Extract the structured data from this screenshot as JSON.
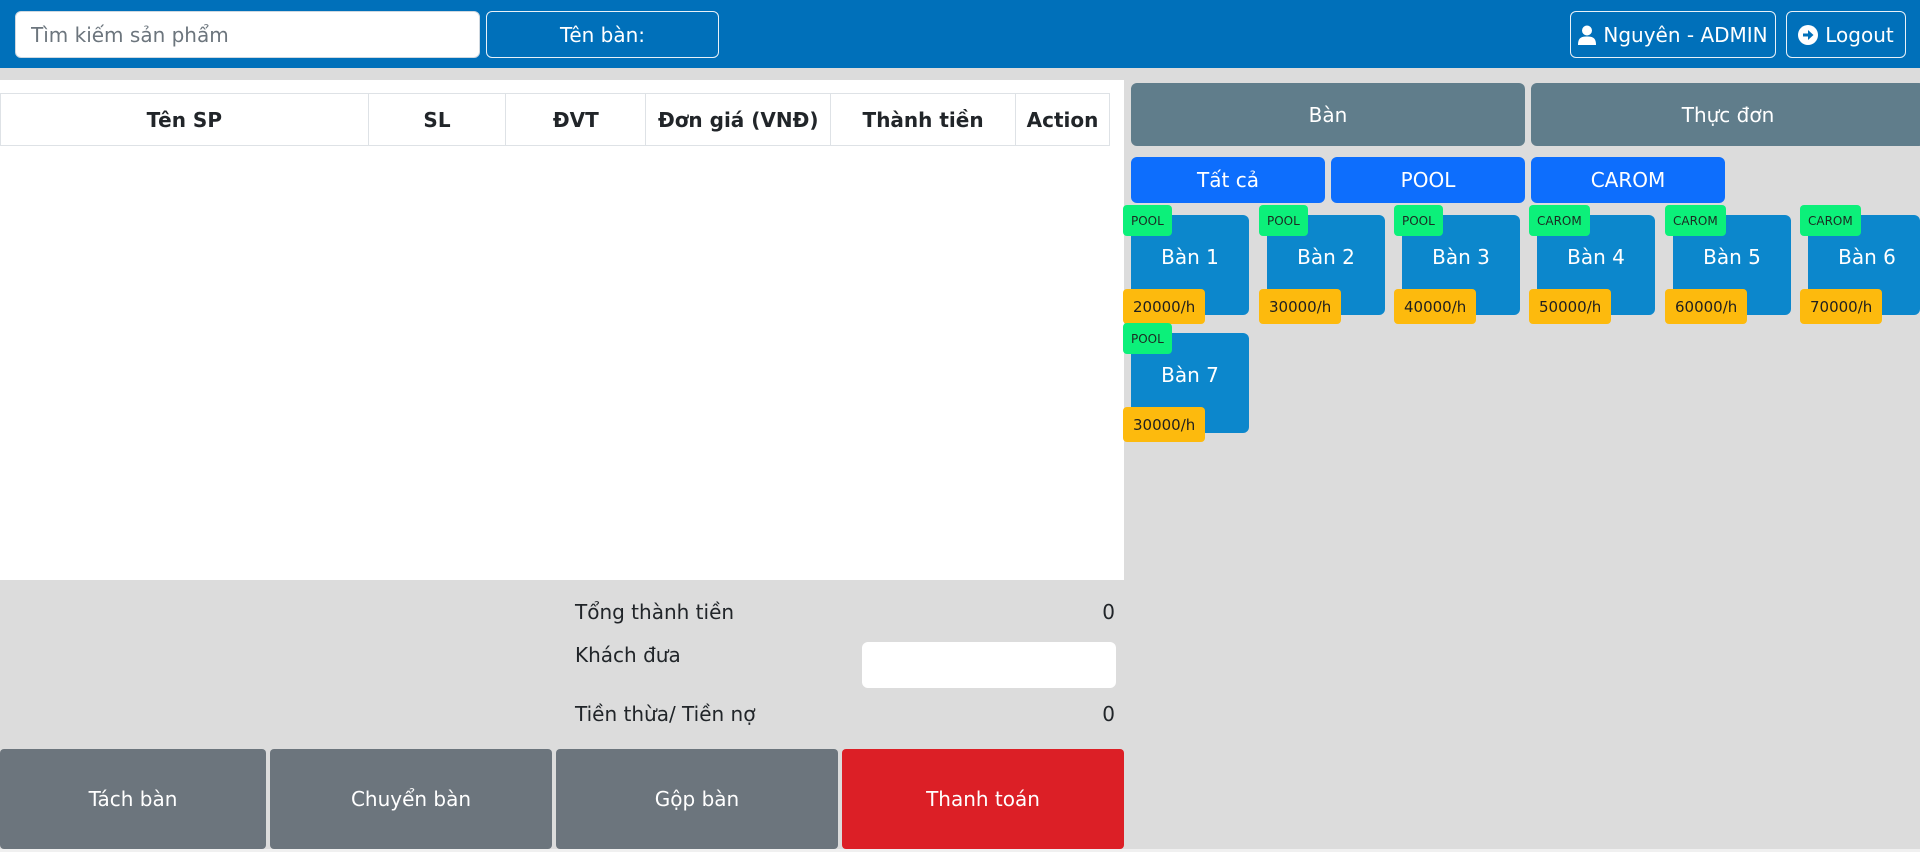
{
  "header": {
    "search_placeholder": "Tìm kiếm sản phẩm",
    "table_name_label": "Tên bàn:",
    "user_label": "Nguyên - ADMIN",
    "logout_label": "Logout",
    "user_icon": "user-icon",
    "logout_icon": "arrow-circle-right-icon",
    "brand_color": "#0070ba"
  },
  "order": {
    "columns": [
      "Tên SP",
      "SL",
      "ĐVT",
      "Đơn giá (VNĐ)",
      "Thành tiền",
      "Action"
    ],
    "rows": []
  },
  "totals": {
    "total_label": "Tổng thành tiền",
    "total_value": "0",
    "paid_label": "Khách đưa",
    "paid_value": "",
    "change_label": "Tiền thừa/ Tiền nợ",
    "change_value": "0"
  },
  "actions": {
    "split_label": "Tách bàn",
    "move_label": "Chuyển bàn",
    "merge_label": "Gộp bàn",
    "pay_label": "Thanh toán",
    "pay_color": "#dc1f26",
    "secondary_color": "#6c757d"
  },
  "tabs": {
    "tables_label": "Bàn",
    "menu_label": "Thực đơn"
  },
  "filters": {
    "all_label": "Tất cả",
    "pool_label": "POOL",
    "carom_label": "CAROM"
  },
  "pool_tables": [
    {
      "name": "Bàn 1",
      "type": "POOL",
      "price": "20000/h"
    },
    {
      "name": "Bàn 2",
      "type": "POOL",
      "price": "30000/h"
    },
    {
      "name": "Bàn 3",
      "type": "POOL",
      "price": "40000/h"
    },
    {
      "name": "Bàn 4",
      "type": "CAROM",
      "price": "50000/h"
    },
    {
      "name": "Bàn 5",
      "type": "CAROM",
      "price": "60000/h"
    },
    {
      "name": "Bàn 6",
      "type": "CAROM",
      "price": "70000/h"
    },
    {
      "name": "Bàn 7",
      "type": "POOL",
      "price": "30000/h"
    }
  ]
}
